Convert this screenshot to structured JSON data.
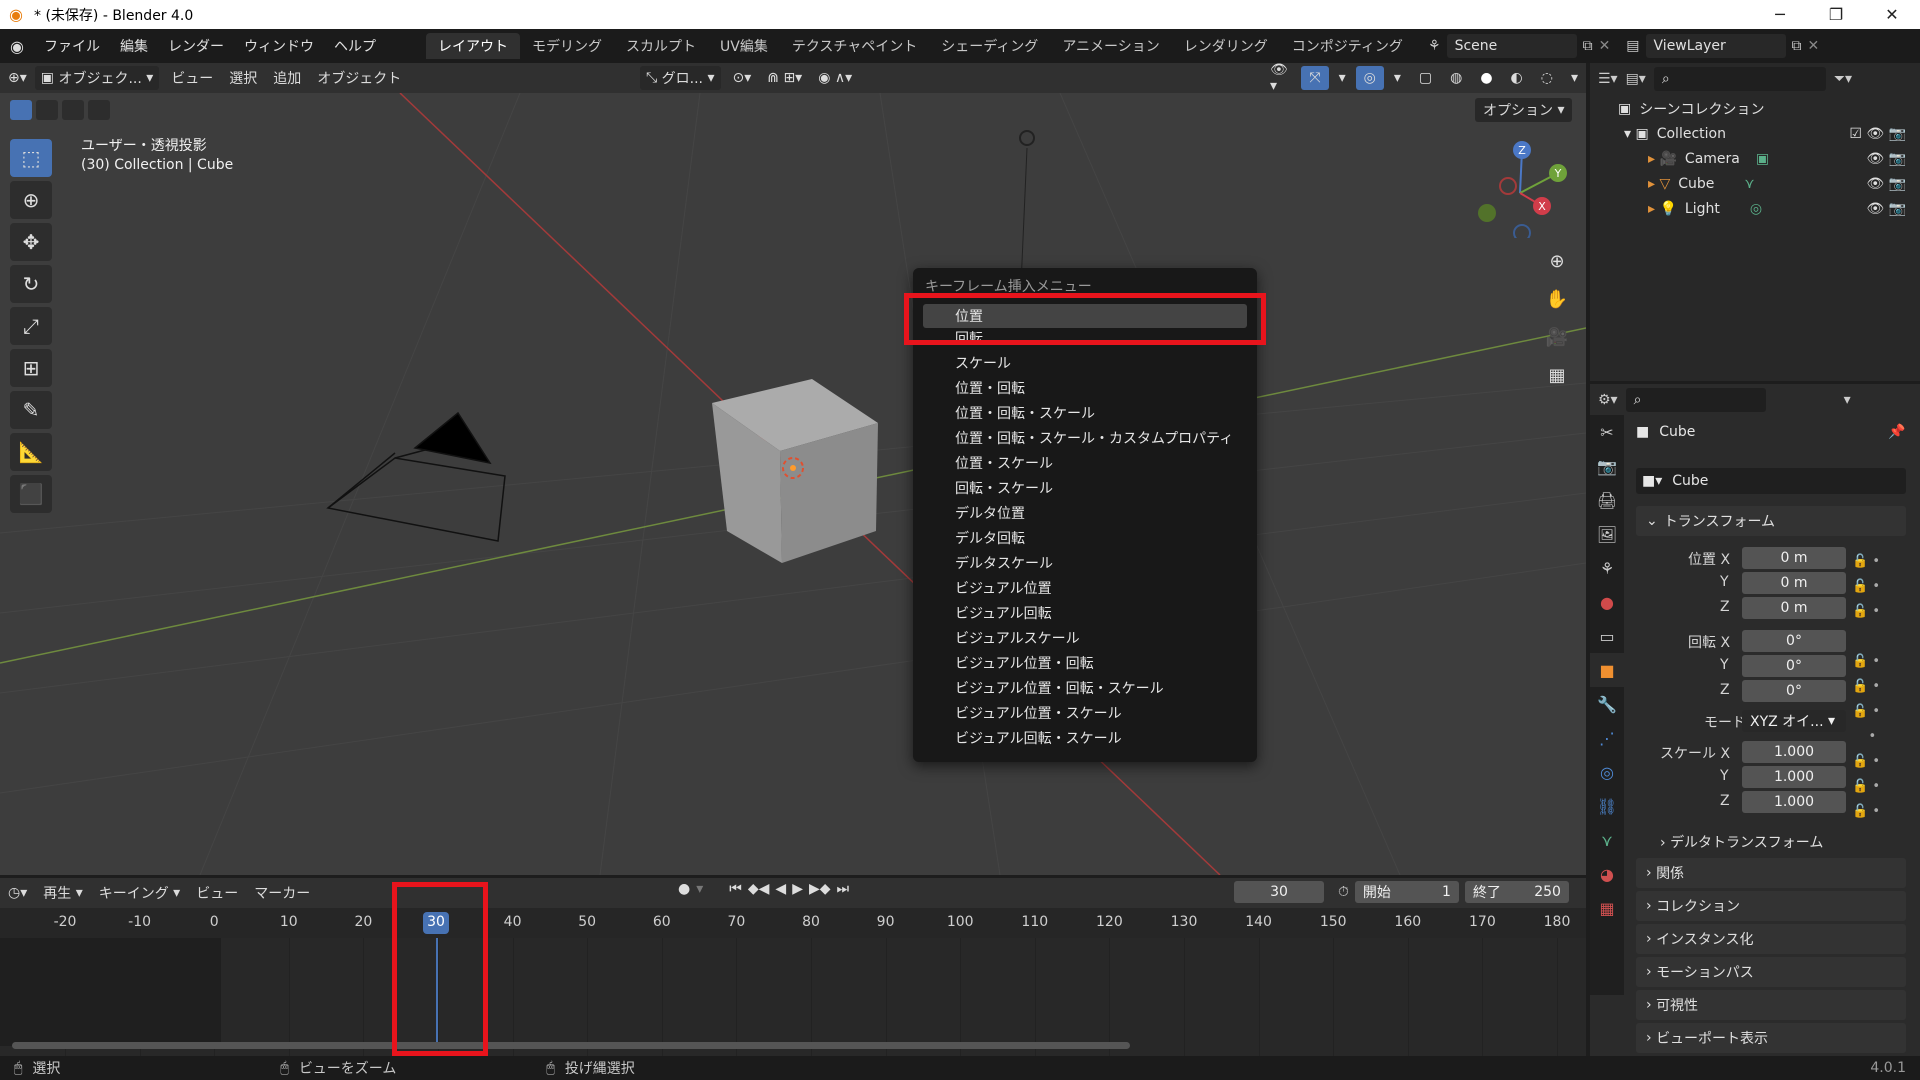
{
  "window": {
    "title": "* (未保存) - Blender 4.0",
    "controls": {
      "minimize": "─",
      "maximize": "❐",
      "close": "✕"
    }
  },
  "menu": {
    "file": "ファイル",
    "edit": "編集",
    "render": "レンダー",
    "window": "ウィンドウ",
    "help": "ヘルプ"
  },
  "workspaces": [
    {
      "label": "レイアウト",
      "active": true
    },
    {
      "label": "モデリング"
    },
    {
      "label": "スカルプト"
    },
    {
      "label": "UV編集"
    },
    {
      "label": "テクスチャペイント"
    },
    {
      "label": "シェーディング"
    },
    {
      "label": "アニメーション"
    },
    {
      "label": "レンダリング"
    },
    {
      "label": "コンポジティング"
    }
  ],
  "scene_name": "Scene",
  "view_layer": "ViewLayer",
  "viewport": {
    "mode": "オブジェク...",
    "menus": {
      "view": "ビュー",
      "select": "選択",
      "add": "追加",
      "object": "オブジェクト"
    },
    "transform_orientation": "グロ...",
    "options_label": "オプション",
    "info_line1": "ユーザー・透視投影",
    "info_line2": "(30) Collection | Cube",
    "gizmo": {
      "x": "X",
      "y": "Y",
      "z": "Z"
    }
  },
  "keyframe_menu": {
    "title": "キーフレーム挿入メニュー",
    "items": [
      "位置",
      "回転",
      "スケール",
      "位置・回転",
      "位置・回転・スケール",
      "位置・回転・スケール・カスタムプロパティ",
      "位置・スケール",
      "回転・スケール",
      "デルタ位置",
      "デルタ回転",
      "デルタスケール",
      "ビジュアル位置",
      "ビジュアル回転",
      "ビジュアルスケール",
      "ビジュアル位置・回転",
      "ビジュアル位置・回転・スケール",
      "ビジュアル位置・スケール",
      "ビジュアル回転・スケール"
    ],
    "highlighted_index": 0
  },
  "outliner": {
    "scene_collection": "シーンコレクション",
    "collection": "Collection",
    "objects": [
      "Camera",
      "Cube",
      "Light"
    ]
  },
  "properties": {
    "object_name": "Cube",
    "object_data_name": "Cube",
    "transform_label": "トランスフォーム",
    "location_label": "位置 X",
    "rotation_label": "回転 X",
    "scale_label": "スケール X",
    "axis_y": "Y",
    "axis_z": "Z",
    "location": [
      "0 m",
      "0 m",
      "0 m"
    ],
    "rotation": [
      "0°",
      "0°",
      "0°"
    ],
    "mode_label": "モード",
    "mode_value": "XYZ オイ...",
    "scale": [
      "1.000",
      "1.000",
      "1.000"
    ],
    "delta_transform": "デルタトランスフォーム",
    "panels": [
      "関係",
      "コレクション",
      "インスタンス化",
      "モーションパス",
      "可視性",
      "ビューポート表示"
    ]
  },
  "timeline": {
    "menus": {
      "playback": "再生",
      "keying": "キーイング",
      "view": "ビュー",
      "marker": "マーカー"
    },
    "current_frame": "30",
    "start_label": "開始",
    "start": "1",
    "end_label": "終了",
    "end": "250",
    "ticks": [
      "-20",
      "-10",
      "0",
      "10",
      "20",
      "30",
      "40",
      "50",
      "60",
      "70",
      "80",
      "90",
      "100",
      "110",
      "120",
      "130",
      "140",
      "150",
      "160",
      "170",
      "180"
    ]
  },
  "statusbar": {
    "select": "選択",
    "zoom": "ビューをズーム",
    "lasso": "投げ縄選択",
    "version": "4.0.1"
  }
}
